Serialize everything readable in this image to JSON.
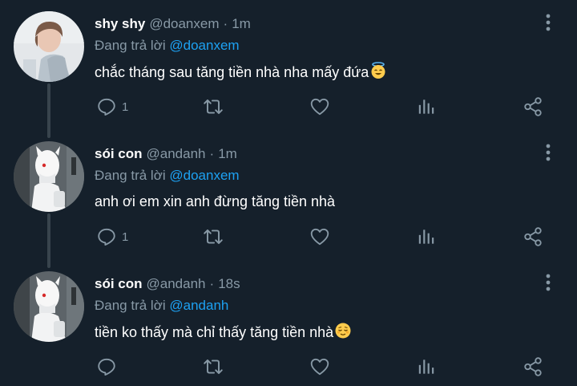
{
  "tweets": [
    {
      "name": "shy shy",
      "handle": "@doanxem",
      "separator": "·",
      "time": "1m",
      "replying_prefix": "Đang trả lời",
      "replying_to": "@doanxem",
      "text": "chắc tháng sau tăng tiền nhà nha mấy đứa",
      "emoji": "smiling-face-with-halo",
      "reply_count": "1",
      "avatar": "avatar-shy-shy"
    },
    {
      "name": "sói con",
      "handle": "@andanh",
      "separator": "·",
      "time": "1m",
      "replying_prefix": "Đang trả lời",
      "replying_to": "@doanxem",
      "text": "anh ơi em xin anh đừng tăng tiền nhà",
      "emoji": "",
      "reply_count": "1",
      "avatar": "avatar-soi-con"
    },
    {
      "name": "sói con",
      "handle": "@andanh",
      "separator": "·",
      "time": "18s",
      "replying_prefix": "Đang trả lời",
      "replying_to": "@andanh",
      "text": "tiền ko thấy mà chỉ thấy tăng tiền nhà",
      "emoji": "relieved-face",
      "reply_count": "",
      "avatar": "avatar-soi-con"
    }
  ],
  "colors": {
    "background": "#15202b",
    "primary_text": "#ffffff",
    "secondary_text": "#8899a6",
    "mention": "#1da1f2",
    "thread_line": "#38444d"
  },
  "icons": {
    "reply": "reply-icon",
    "retweet": "retweet-icon",
    "like": "heart-icon",
    "stats": "stats-icon",
    "share": "share-icon",
    "more": "more-vertical-icon"
  }
}
